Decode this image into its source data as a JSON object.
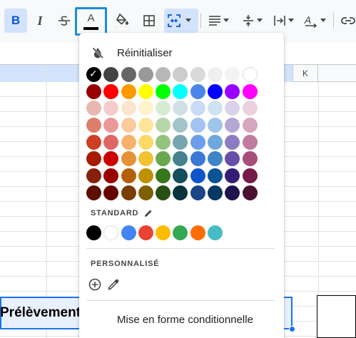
{
  "toolbar": {
    "bold_label": "B",
    "italic_label": "I",
    "text_color_label": "A",
    "text_color_current": "#000000",
    "accent": "#1a8ee0",
    "icons": [
      "strikethrough-icon",
      "fill-color-icon",
      "borders-icon",
      "merge-cells-icon",
      "horizontal-align-icon",
      "vertical-align-icon",
      "text-wrap-icon",
      "text-rotation-icon",
      "insert-link-icon"
    ]
  },
  "sheet": {
    "column_header": "K",
    "cell_text": "Prélèvement"
  },
  "color_menu": {
    "reset_label": "Réinitialiser",
    "selected_color": "#000000",
    "palette": [
      [
        "#000000",
        "#434343",
        "#666666",
        "#999999",
        "#b7b7b7",
        "#cccccc",
        "#d9d9d9",
        "#efefef",
        "#f3f3f3",
        "#ffffff"
      ],
      [
        "#980000",
        "#ff0000",
        "#ff9900",
        "#ffff00",
        "#00ff00",
        "#00ffff",
        "#4a86e8",
        "#0000ff",
        "#9900ff",
        "#ff00ff"
      ],
      [
        "#e6b8af",
        "#f4cccc",
        "#fce5cd",
        "#fff2cc",
        "#d9ead3",
        "#d0e0e3",
        "#c9daf8",
        "#cfe2f3",
        "#d9d2e9",
        "#ead1dc"
      ],
      [
        "#dd7e6b",
        "#ea9999",
        "#f9cb9c",
        "#ffe599",
        "#b6d7a8",
        "#a2c4c9",
        "#a4c2f4",
        "#9fc5e8",
        "#b4a7d6",
        "#d5a6bd"
      ],
      [
        "#cc4125",
        "#e06666",
        "#f6b26b",
        "#ffd966",
        "#93c47d",
        "#76a5af",
        "#6d9eeb",
        "#6fa8dc",
        "#8e7cc3",
        "#c27ba0"
      ],
      [
        "#a61c00",
        "#cc0000",
        "#e69138",
        "#f1c232",
        "#6aa84f",
        "#45818e",
        "#3c78d8",
        "#3d85c6",
        "#674ea7",
        "#a64d79"
      ],
      [
        "#85200c",
        "#990000",
        "#b45f06",
        "#bf9000",
        "#38761d",
        "#134f5c",
        "#1155cc",
        "#0b5394",
        "#351c75",
        "#741b47"
      ],
      [
        "#5b0f00",
        "#660000",
        "#783f04",
        "#7f6000",
        "#274e13",
        "#0c343d",
        "#1c4587",
        "#073763",
        "#20124d",
        "#4c1130"
      ]
    ],
    "standard_label": "STANDARD",
    "standard_colors": [
      "#000000",
      "#ffffff",
      "#4285f4",
      "#ea4335",
      "#fbbc04",
      "#34a853",
      "#ff6d01",
      "#46bdc6"
    ],
    "custom_label": "PERSONNALISÉ",
    "conditional_label": "Mise en forme conditionnelle"
  }
}
